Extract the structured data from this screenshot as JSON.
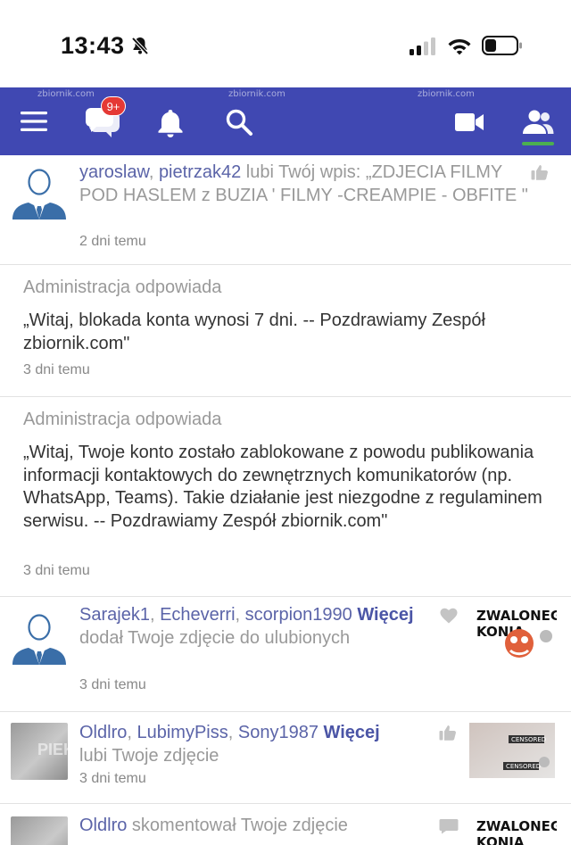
{
  "status": {
    "time": "13:43"
  },
  "nav": {
    "badge": "9+",
    "watermark": "zbiornik.com"
  },
  "feed": [
    {
      "users": [
        "yaroslaw",
        "pietrzak42"
      ],
      "sep1": ", ",
      "action": " lubi Twój wpis: „ZDJECIA FILMY POD HASLEM z BUZIA ' FILMY -CREAMPIE - OBFITE \"",
      "time": "2 dni temu"
    },
    {
      "title": "Administracja odpowiada",
      "body": "„Witaj, blokada konta wynosi 7 dni. -- Pozdrawiamy Zespół zbiornik.com\"",
      "time": "3 dni temu"
    },
    {
      "title": "Administracja odpowiada",
      "body": "„Witaj, Twoje konto zostało zablokowane z powodu publikowania informacji kontaktowych do zewnętrznych komunikatorów (np. WhatsApp, Teams). Takie działanie jest niezgodne z regulaminem serwisu. -- Pozdrawiamy Zespół zbiornik.com\"",
      "time": "3 dni temu"
    },
    {
      "users": [
        "Sarajek1",
        "Echeverri",
        "scorpion1990"
      ],
      "more": "Więcej",
      "action": " dodał Twoje zdjęcie do ulubionych",
      "time": "3 dni temu",
      "thumb_text": "ZWALONEGO KONIA"
    },
    {
      "users": [
        "Oldlro",
        "LubimyPiss",
        "Sony1987"
      ],
      "more": "Więcej",
      "action": "lubi Twoje zdjęcie",
      "time": "3 dni temu",
      "avatar_text": "PIEK",
      "thumb_text": "CENSORED"
    },
    {
      "users": [
        "Oldlro"
      ],
      "action": " skomentował Twoje zdjęcie",
      "thumb_text": "ZWALONEGO KONIA"
    }
  ],
  "sep": ", ",
  "space": " "
}
